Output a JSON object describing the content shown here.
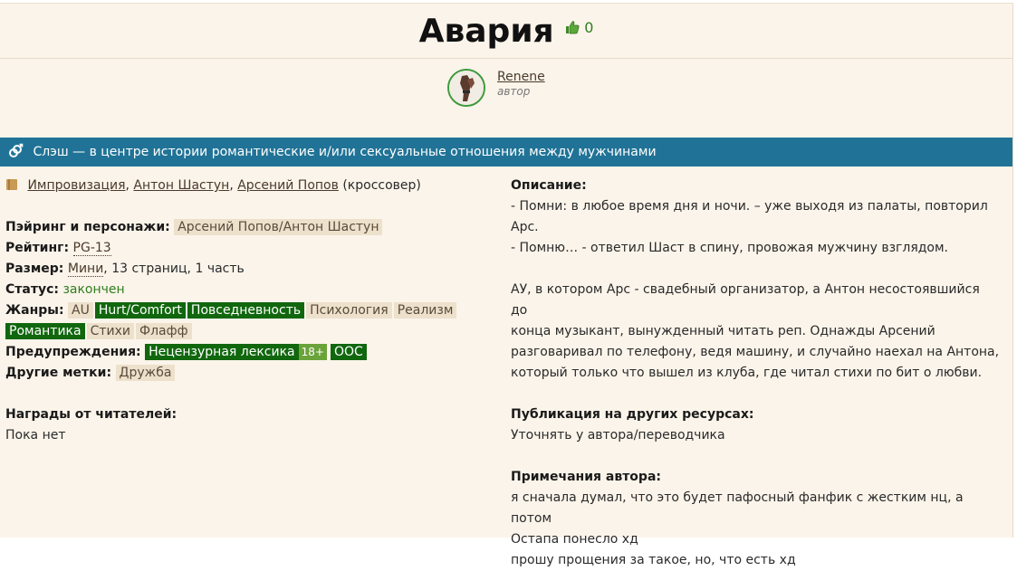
{
  "header": {
    "title": "Авария",
    "likes": "0"
  },
  "author": {
    "name": "Renene",
    "role": "автор"
  },
  "direction": {
    "text": "Слэш — в центре истории романтические и/или сексуальные отношения между мужчинами"
  },
  "fandom": {
    "items": [
      "Импровизация",
      "Антон Шастун",
      "Арсений Попов"
    ],
    "suffix": "(кроссовер)"
  },
  "info": {
    "pairing_label": "Пэйринг и персонажи:",
    "pairing_value": "Арсений Попов/Антон Шастун",
    "rating_label": "Рейтинг:",
    "rating_value": "PG-13",
    "size_label": "Размер:",
    "size_value": "Мини",
    "size_rest": ", 13 страниц, 1 часть",
    "status_label": "Статус:",
    "status_value": "закончен",
    "genres_label": "Жанры:",
    "genres": [
      "AU",
      "Hurt/Comfort",
      "Повседневность",
      "Психология",
      "Реализм",
      "Романтика",
      "Стихи",
      "Флафф"
    ],
    "warnings_label": "Предупреждения:",
    "warnings": [
      "Нецензурная лексика",
      "ООС"
    ],
    "warning_age": "18+",
    "other_label": "Другие метки:",
    "other_tags": [
      "Дружба"
    ],
    "awards_label": "Награды от читателей:",
    "awards_value": "Пока нет"
  },
  "description": {
    "label": "Описание:",
    "lines": [
      "- Помни: в любое время дня и ночи. – уже выходя из палаты, повторил",
      "Арс.",
      "- Помню… - ответил Шаст в спину, провожая мужчину взглядом.",
      "АУ, в котором Арс - свадебный организатор, а Антон несостоявшийся до",
      "конца музыкант, вынужденный читать реп. Однажды Арсений",
      "разговаривал по телефону, ведя машину, и случайно наехал на Антона,",
      "который только что вышел из клуба, где читал стихи по бит о любви."
    ]
  },
  "publication": {
    "label": "Публикация на других ресурсах:",
    "value": "Уточнять у автора/переводчика"
  },
  "notes": {
    "label": "Примечания автора:",
    "lines": [
      "я сначала думал, что это будет пафосный фанфик с жестким нц, а потом",
      "Остапа понесло хд",
      "прошу прощения за такое, но, что есть хд"
    ]
  },
  "colors": {
    "accent_bar": "#207396",
    "tag_green": "#11670e",
    "background": "#fbf4ea"
  }
}
